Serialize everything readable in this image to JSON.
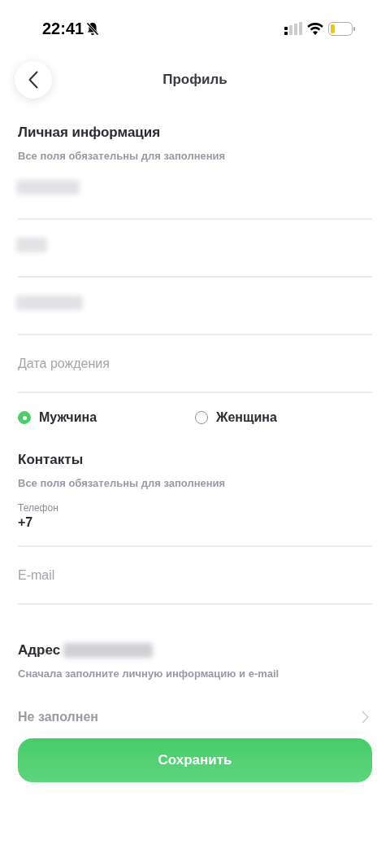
{
  "status_bar": {
    "time": "22:41"
  },
  "header": {
    "title": "Профиль"
  },
  "personal": {
    "title": "Личная информация",
    "subtitle": "Все поля обязательны для заполнения",
    "fields": [
      {
        "kind": "redacted"
      },
      {
        "kind": "redacted"
      },
      {
        "kind": "redacted"
      },
      {
        "kind": "input",
        "placeholder": "Дата рождения"
      }
    ],
    "gender": [
      {
        "label": "Мужчина",
        "selected": true
      },
      {
        "label": "Женщина",
        "selected": false
      }
    ]
  },
  "contacts": {
    "title": "Контакты",
    "subtitle": "Все поля обязательны для заполнения",
    "fields": [
      {
        "kind": "labeled",
        "label": "Телефон",
        "value": "+7"
      },
      {
        "kind": "input",
        "placeholder": "E-mail"
      }
    ]
  },
  "address": {
    "title": "Адрес",
    "redacted": true,
    "subtitle": "Сначала заполните личную информацию и e-mail",
    "value": "Не заполнен"
  },
  "save_button": {
    "label": "Сохранить"
  }
}
